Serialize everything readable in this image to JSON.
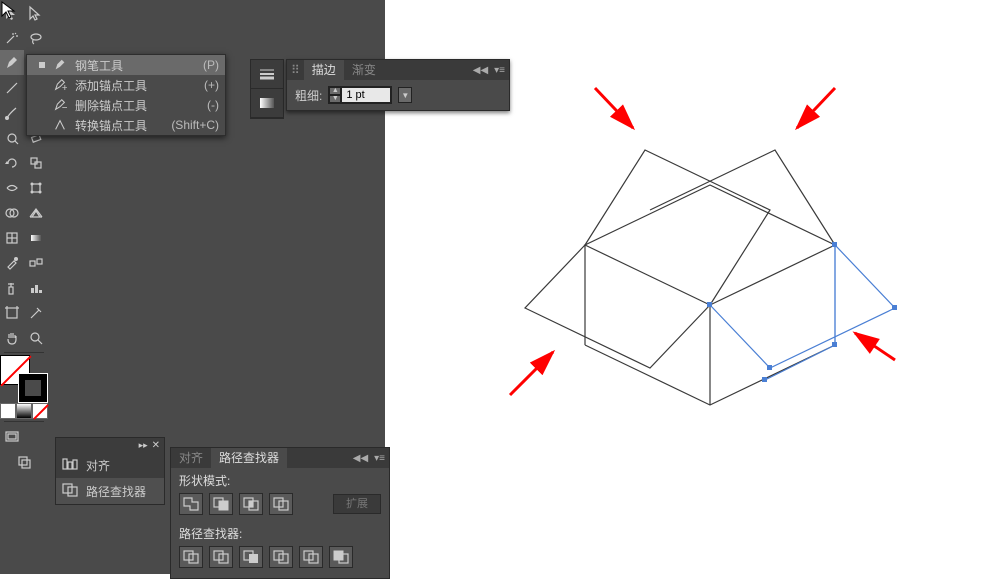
{
  "flyout": {
    "items": [
      {
        "label": "钢笔工具",
        "shortcut": "(P)",
        "selected": true,
        "icon": "pen"
      },
      {
        "label": "添加锚点工具",
        "shortcut": "(+)",
        "selected": false,
        "icon": "pen-plus"
      },
      {
        "label": "删除锚点工具",
        "shortcut": "(-)",
        "selected": false,
        "icon": "pen-minus"
      },
      {
        "label": "转换锚点工具",
        "shortcut": "(Shift+C)",
        "selected": false,
        "icon": "convert"
      }
    ]
  },
  "stroke_panel": {
    "tabs": [
      "描边",
      "渐变"
    ],
    "active_tab": 0,
    "label": "粗细:",
    "value": "1 pt"
  },
  "dock": {
    "items": [
      {
        "label": "对齐",
        "icon": "align"
      },
      {
        "label": "路径查找器",
        "icon": "pathfinder"
      }
    ]
  },
  "pathfinder_panel": {
    "tabs": [
      "对齐",
      "路径查找器"
    ],
    "active_tab": 1,
    "shape_mode_label": "形状模式:",
    "pathfinder_label": "路径查找器:",
    "expand_label": "扩展"
  },
  "colors": {
    "accent": "#ff0000",
    "panel": "#4a4a4a",
    "selected": "#6a6a6a"
  }
}
